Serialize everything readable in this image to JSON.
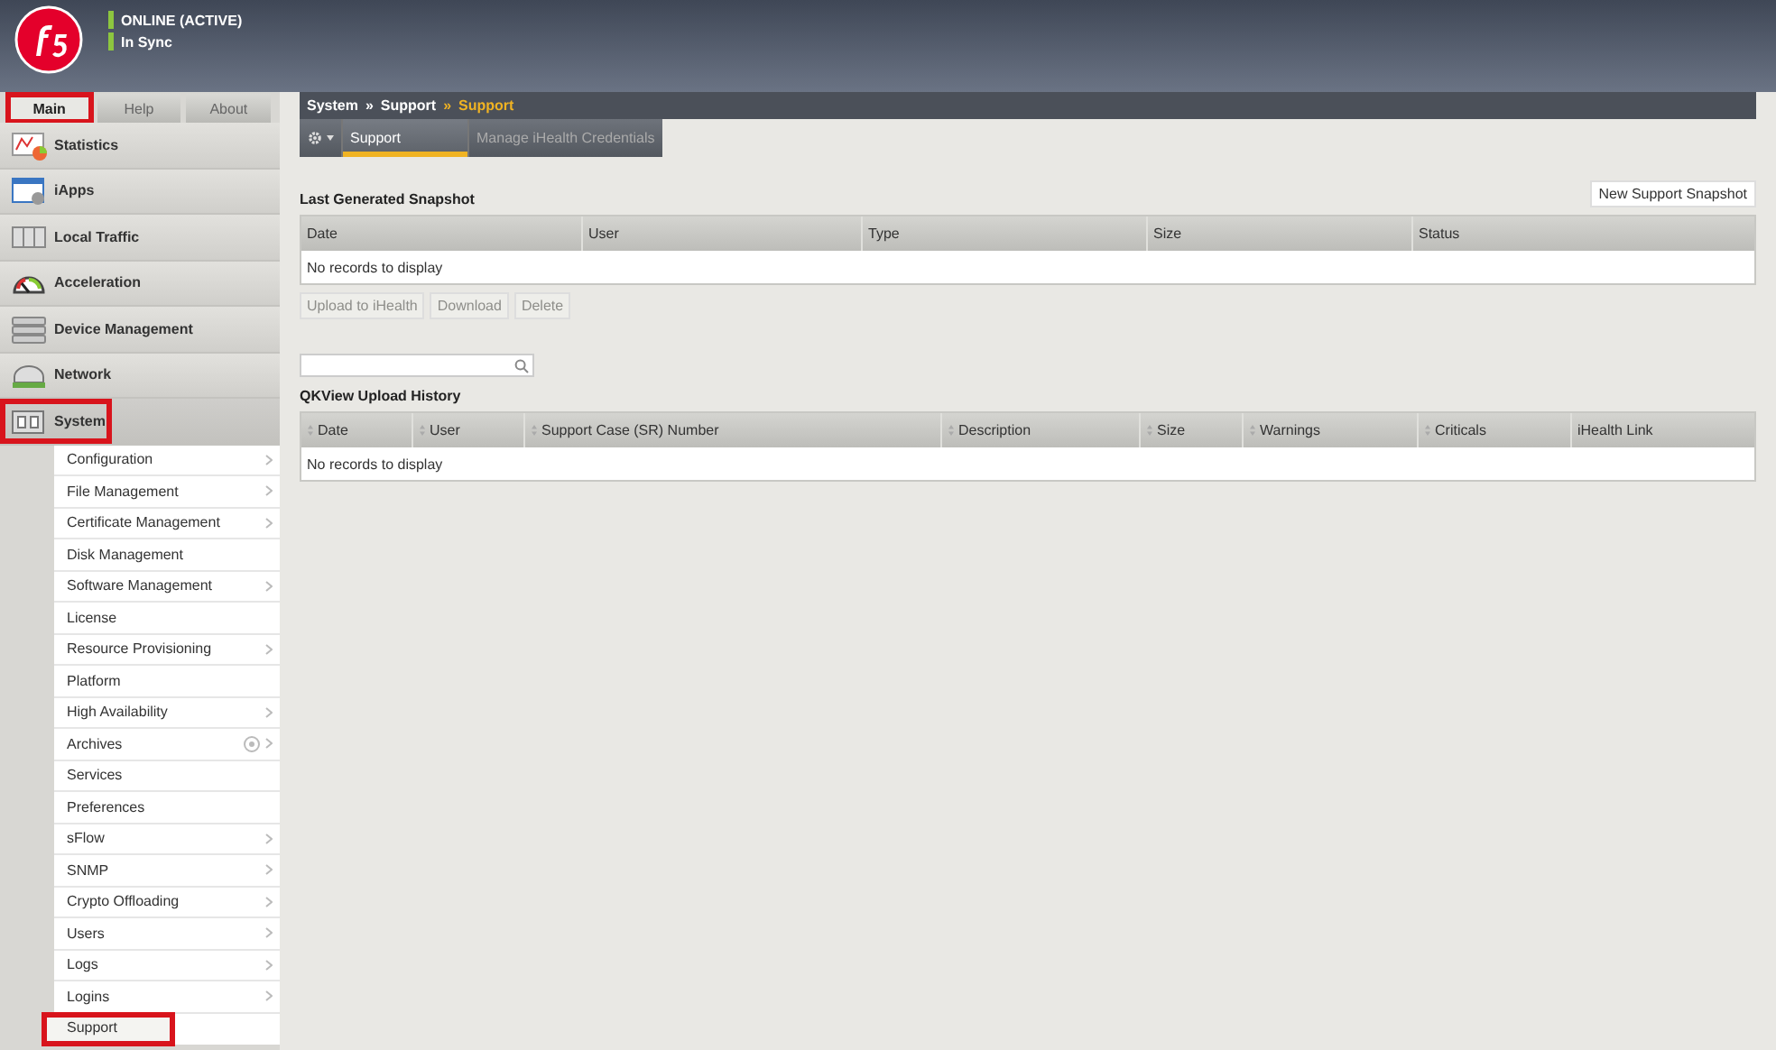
{
  "header": {
    "status": [
      {
        "label": "ONLINE (ACTIVE)",
        "color": "#8dc63f"
      },
      {
        "label": "In Sync",
        "color": "#8dc63f"
      }
    ]
  },
  "sidebar": {
    "tabs": [
      {
        "label": "Main",
        "selected": true,
        "highlighted": true
      },
      {
        "label": "Help",
        "selected": false,
        "highlighted": false
      },
      {
        "label": "About",
        "selected": false,
        "highlighted": false
      }
    ],
    "nav": [
      {
        "label": "Statistics",
        "selected": false,
        "highlighted": false
      },
      {
        "label": "iApps",
        "selected": false,
        "highlighted": false
      },
      {
        "label": "Local Traffic",
        "selected": false,
        "highlighted": false
      },
      {
        "label": "Acceleration",
        "selected": false,
        "highlighted": false
      },
      {
        "label": "Device Management",
        "selected": false,
        "highlighted": false
      },
      {
        "label": "Network",
        "selected": false,
        "highlighted": false
      },
      {
        "label": "System",
        "selected": true,
        "highlighted": true,
        "children": [
          {
            "label": "Configuration",
            "has_submenu": true,
            "selected": false,
            "highlighted": false
          },
          {
            "label": "File Management",
            "has_submenu": true,
            "selected": false,
            "highlighted": false
          },
          {
            "label": "Certificate Management",
            "has_submenu": true,
            "selected": false,
            "highlighted": false
          },
          {
            "label": "Disk Management",
            "has_submenu": false,
            "selected": false,
            "highlighted": false
          },
          {
            "label": "Software Management",
            "has_submenu": true,
            "selected": false,
            "highlighted": false
          },
          {
            "label": "License",
            "has_submenu": false,
            "selected": false,
            "highlighted": false
          },
          {
            "label": "Resource Provisioning",
            "has_submenu": true,
            "selected": false,
            "highlighted": false
          },
          {
            "label": "Platform",
            "has_submenu": false,
            "selected": false,
            "highlighted": false
          },
          {
            "label": "High Availability",
            "has_submenu": true,
            "selected": false,
            "highlighted": false
          },
          {
            "label": "Archives",
            "has_submenu": true,
            "add_button": true,
            "selected": false,
            "highlighted": false
          },
          {
            "label": "Services",
            "has_submenu": false,
            "selected": false,
            "highlighted": false
          },
          {
            "label": "Preferences",
            "has_submenu": false,
            "selected": false,
            "highlighted": false
          },
          {
            "label": "sFlow",
            "has_submenu": true,
            "selected": false,
            "highlighted": false
          },
          {
            "label": "SNMP",
            "has_submenu": true,
            "selected": false,
            "highlighted": false
          },
          {
            "label": "Crypto Offloading",
            "has_submenu": true,
            "selected": false,
            "highlighted": false
          },
          {
            "label": "Users",
            "has_submenu": true,
            "selected": false,
            "highlighted": false
          },
          {
            "label": "Logs",
            "has_submenu": true,
            "selected": false,
            "highlighted": false
          },
          {
            "label": "Logins",
            "has_submenu": true,
            "selected": false,
            "highlighted": false
          },
          {
            "label": "Support",
            "has_submenu": false,
            "selected": true,
            "highlighted": true
          }
        ]
      }
    ]
  },
  "main": {
    "breadcrumb": [
      {
        "label": "System",
        "current": false
      },
      {
        "label": "»",
        "current": false
      },
      {
        "label": "Support",
        "current": false
      },
      {
        "label": "»",
        "current": true
      },
      {
        "label": "Support",
        "current": true
      }
    ],
    "tabs": [
      {
        "label": "Support",
        "selected": true
      },
      {
        "label": "Manage iHealth Credentials",
        "selected": false
      }
    ],
    "snapshot": {
      "title": "Last Generated Snapshot",
      "action_button": "New Support Snapshot",
      "columns": [
        {
          "label": "Date",
          "sortable": false
        },
        {
          "label": "User",
          "sortable": false
        },
        {
          "label": "Type",
          "sortable": false
        },
        {
          "label": "Size",
          "sortable": false
        },
        {
          "label": "Status",
          "sortable": false
        }
      ],
      "empty_message": "No records to display",
      "buttons": [
        {
          "label": "Upload to iHealth",
          "disabled": true
        },
        {
          "label": "Download",
          "disabled": true
        },
        {
          "label": "Delete",
          "disabled": true
        }
      ]
    },
    "history": {
      "title": "QKView Upload History",
      "columns": [
        {
          "label": "Date",
          "sortable": true
        },
        {
          "label": "User",
          "sortable": true
        },
        {
          "label": "Support Case (SR) Number",
          "sortable": true
        },
        {
          "label": "Description",
          "sortable": true
        },
        {
          "label": "Size",
          "sortable": true
        },
        {
          "label": "Warnings",
          "sortable": true
        },
        {
          "label": "Criticals",
          "sortable": true
        },
        {
          "label": "iHealth Link",
          "sortable": false
        }
      ],
      "empty_message": "No records to display"
    }
  }
}
